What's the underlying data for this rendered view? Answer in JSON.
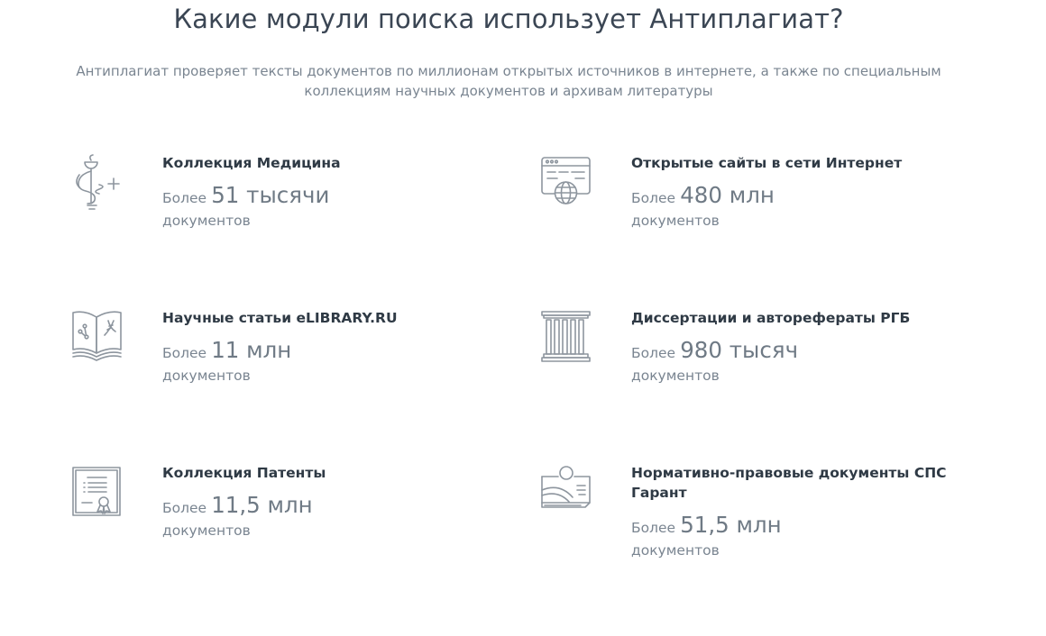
{
  "heading": "Какие модули поиска использует Антиплагиат?",
  "subtitle": "Антиплагиат проверяет тексты документов по миллионам открытых источников в интернете, а также по специальным коллекциям научных документов и архивам литературы",
  "modules": [
    {
      "name": "Коллекция Медицина",
      "prefix": "Более",
      "value": "51 тысячи",
      "unit": "документов",
      "icon": "medicine-icon"
    },
    {
      "name": "Открытые сайты в сети Интернет",
      "prefix": "Более",
      "value": "480 млн",
      "unit": "документов",
      "icon": "web-browser-globe-icon"
    },
    {
      "name": "Научные статьи eLIBRARY.RU",
      "prefix": "Более",
      "value": "11 млн",
      "unit": "документов",
      "icon": "open-book-icon"
    },
    {
      "name": "Диссертации и авторефераты РГБ",
      "prefix": "Более",
      "value": "980 тысяч",
      "unit": "документов",
      "icon": "library-columns-icon"
    },
    {
      "name": "Коллекция Патенты",
      "prefix": "Более",
      "value": "11,5 млн",
      "unit": "документов",
      "icon": "patent-certificate-icon"
    },
    {
      "name": "Нормативно-правовые документы СПС Гарант",
      "prefix": "Более",
      "value": "51,5 млн",
      "unit": "документов",
      "icon": "legal-document-icon"
    }
  ]
}
